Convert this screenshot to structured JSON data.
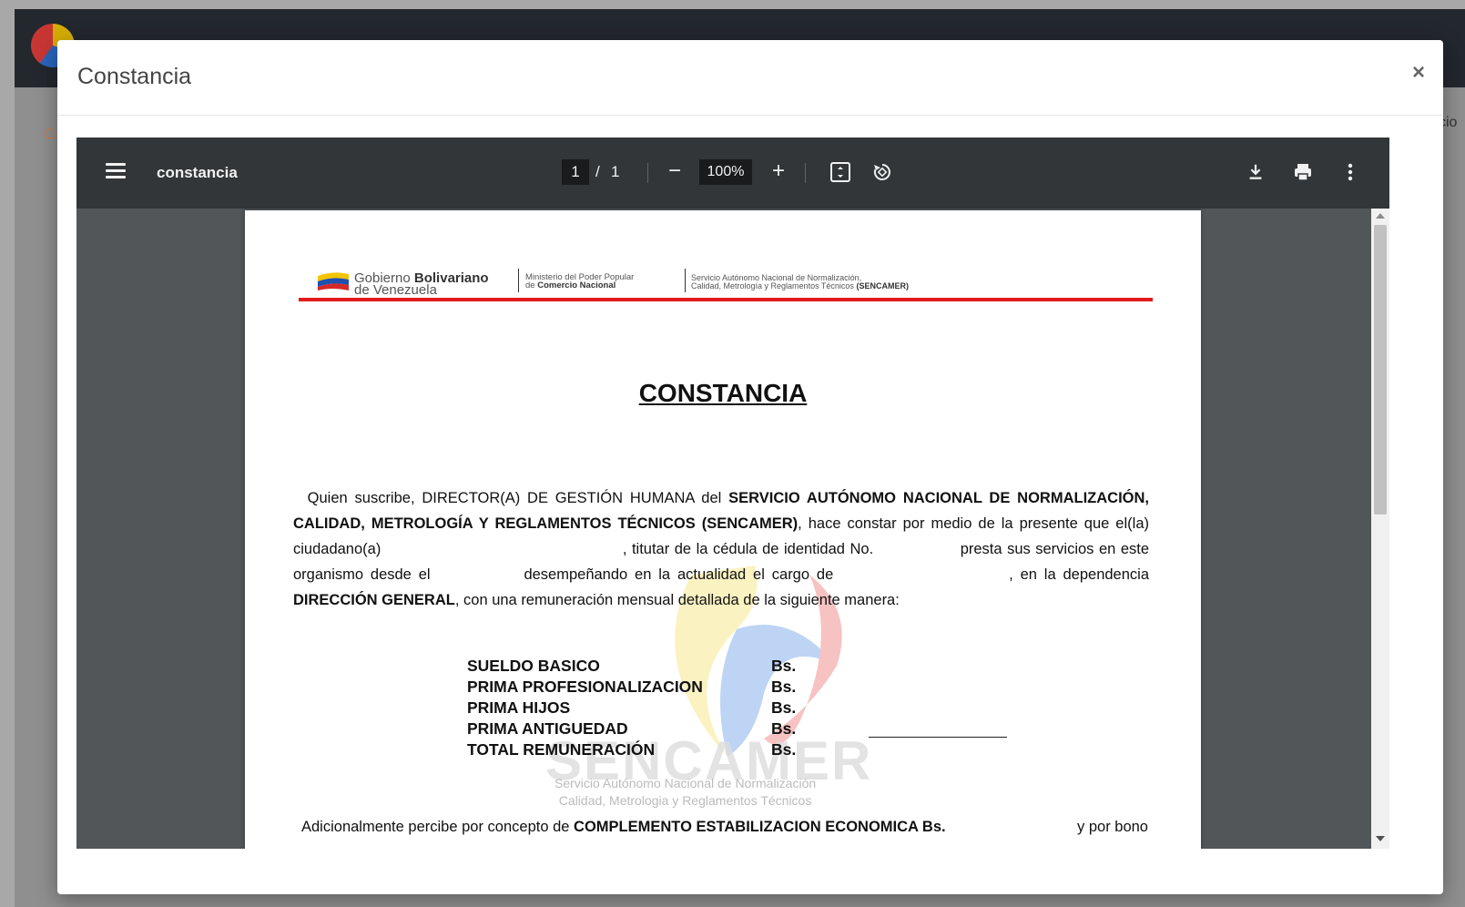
{
  "background": {
    "right_text": "cio"
  },
  "modal": {
    "title": "Constancia",
    "close_label": "×"
  },
  "viewer": {
    "filename": "constancia",
    "page_current": "1",
    "page_separator": "/",
    "page_total": "1",
    "zoom": "100%"
  },
  "document": {
    "letterhead": {
      "gob_line1_light": "Gobierno",
      "gob_line1_bold": "Bolivariano",
      "gob_line2": "de Venezuela",
      "ministry_line1": "Ministerio del Poder Popular",
      "ministry_line2_light": "de",
      "ministry_line2_bold": "Comercio Nacional",
      "sencamer_line1": "Servicio Autónomo Nacional de Normalización,",
      "sencamer_line2_light": "Calidad, Metrología y Reglamentos Técnicos",
      "sencamer_line2_bold": "(SENCAMER)"
    },
    "title": "CONSTANCIA",
    "paragraph": {
      "p1": "Quien suscribe, DIRECTOR(A) DE GESTIÓN HUMANA del",
      "p1_bold": "SERVICIO AUTÓNOMO NACIONAL DE NORMALIZACIÓN, CALIDAD, METROLOGÍA Y REGLAMENTOS TÉCNICOS (SENCAMER)",
      "p2": ", hace constar por medio de la presente que el(la) ciudadano(a)",
      "p3": ", titutar de la cédula de identidad No.",
      "p4": "presta sus servicios en este organismo desde el",
      "p5": "desempeñando en la actualidad el cargo de",
      "p6": ", en la dependencia",
      "p6_bold": "DIRECCIÓN GENERAL",
      "p7": ", con una remuneración mensual detallada de la siguiente manera:"
    },
    "salary_rows": [
      {
        "label": "SUELDO BASICO",
        "currency": "Bs."
      },
      {
        "label": "PRIMA PROFESIONALIZACION",
        "currency": "Bs."
      },
      {
        "label": "PRIMA HIJOS",
        "currency": "Bs."
      },
      {
        "label": "PRIMA ANTIGUEDAD",
        "currency": "Bs."
      },
      {
        "label": "TOTAL REMUNERACIÓN",
        "currency": "Bs."
      }
    ],
    "watermark": {
      "name": "SENCAMER",
      "sub1": "Servicio Autónomo Nacional de Normalización",
      "sub2": "Calidad, Metrologia y Reglamentos Técnicos"
    },
    "additional": {
      "lead": "Adicionalmente percibe por concepto de",
      "bold": "COMPLEMENTO ESTABILIZACION ECONOMICA Bs.",
      "tail": "y por bono"
    }
  },
  "colors": {
    "accent_red": "#e21a1a",
    "toolbar_bg": "#323639",
    "viewer_bg": "#525659"
  }
}
